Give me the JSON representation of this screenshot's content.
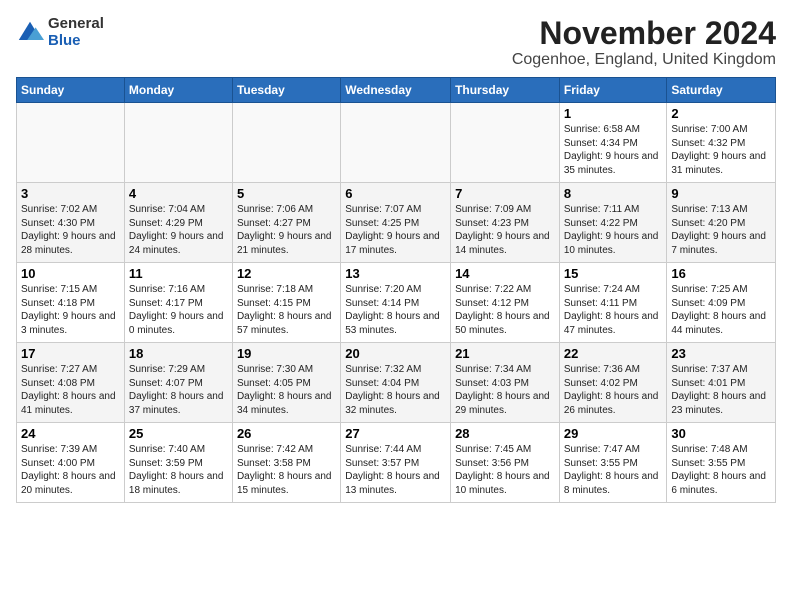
{
  "logo": {
    "general": "General",
    "blue": "Blue"
  },
  "title": "November 2024",
  "location": "Cogenhoe, England, United Kingdom",
  "days_of_week": [
    "Sunday",
    "Monday",
    "Tuesday",
    "Wednesday",
    "Thursday",
    "Friday",
    "Saturday"
  ],
  "weeks": [
    [
      {
        "day": "",
        "info": ""
      },
      {
        "day": "",
        "info": ""
      },
      {
        "day": "",
        "info": ""
      },
      {
        "day": "",
        "info": ""
      },
      {
        "day": "",
        "info": ""
      },
      {
        "day": "1",
        "info": "Sunrise: 6:58 AM\nSunset: 4:34 PM\nDaylight: 9 hours and 35 minutes."
      },
      {
        "day": "2",
        "info": "Sunrise: 7:00 AM\nSunset: 4:32 PM\nDaylight: 9 hours and 31 minutes."
      }
    ],
    [
      {
        "day": "3",
        "info": "Sunrise: 7:02 AM\nSunset: 4:30 PM\nDaylight: 9 hours and 28 minutes."
      },
      {
        "day": "4",
        "info": "Sunrise: 7:04 AM\nSunset: 4:29 PM\nDaylight: 9 hours and 24 minutes."
      },
      {
        "day": "5",
        "info": "Sunrise: 7:06 AM\nSunset: 4:27 PM\nDaylight: 9 hours and 21 minutes."
      },
      {
        "day": "6",
        "info": "Sunrise: 7:07 AM\nSunset: 4:25 PM\nDaylight: 9 hours and 17 minutes."
      },
      {
        "day": "7",
        "info": "Sunrise: 7:09 AM\nSunset: 4:23 PM\nDaylight: 9 hours and 14 minutes."
      },
      {
        "day": "8",
        "info": "Sunrise: 7:11 AM\nSunset: 4:22 PM\nDaylight: 9 hours and 10 minutes."
      },
      {
        "day": "9",
        "info": "Sunrise: 7:13 AM\nSunset: 4:20 PM\nDaylight: 9 hours and 7 minutes."
      }
    ],
    [
      {
        "day": "10",
        "info": "Sunrise: 7:15 AM\nSunset: 4:18 PM\nDaylight: 9 hours and 3 minutes."
      },
      {
        "day": "11",
        "info": "Sunrise: 7:16 AM\nSunset: 4:17 PM\nDaylight: 9 hours and 0 minutes."
      },
      {
        "day": "12",
        "info": "Sunrise: 7:18 AM\nSunset: 4:15 PM\nDaylight: 8 hours and 57 minutes."
      },
      {
        "day": "13",
        "info": "Sunrise: 7:20 AM\nSunset: 4:14 PM\nDaylight: 8 hours and 53 minutes."
      },
      {
        "day": "14",
        "info": "Sunrise: 7:22 AM\nSunset: 4:12 PM\nDaylight: 8 hours and 50 minutes."
      },
      {
        "day": "15",
        "info": "Sunrise: 7:24 AM\nSunset: 4:11 PM\nDaylight: 8 hours and 47 minutes."
      },
      {
        "day": "16",
        "info": "Sunrise: 7:25 AM\nSunset: 4:09 PM\nDaylight: 8 hours and 44 minutes."
      }
    ],
    [
      {
        "day": "17",
        "info": "Sunrise: 7:27 AM\nSunset: 4:08 PM\nDaylight: 8 hours and 41 minutes."
      },
      {
        "day": "18",
        "info": "Sunrise: 7:29 AM\nSunset: 4:07 PM\nDaylight: 8 hours and 37 minutes."
      },
      {
        "day": "19",
        "info": "Sunrise: 7:30 AM\nSunset: 4:05 PM\nDaylight: 8 hours and 34 minutes."
      },
      {
        "day": "20",
        "info": "Sunrise: 7:32 AM\nSunset: 4:04 PM\nDaylight: 8 hours and 32 minutes."
      },
      {
        "day": "21",
        "info": "Sunrise: 7:34 AM\nSunset: 4:03 PM\nDaylight: 8 hours and 29 minutes."
      },
      {
        "day": "22",
        "info": "Sunrise: 7:36 AM\nSunset: 4:02 PM\nDaylight: 8 hours and 26 minutes."
      },
      {
        "day": "23",
        "info": "Sunrise: 7:37 AM\nSunset: 4:01 PM\nDaylight: 8 hours and 23 minutes."
      }
    ],
    [
      {
        "day": "24",
        "info": "Sunrise: 7:39 AM\nSunset: 4:00 PM\nDaylight: 8 hours and 20 minutes."
      },
      {
        "day": "25",
        "info": "Sunrise: 7:40 AM\nSunset: 3:59 PM\nDaylight: 8 hours and 18 minutes."
      },
      {
        "day": "26",
        "info": "Sunrise: 7:42 AM\nSunset: 3:58 PM\nDaylight: 8 hours and 15 minutes."
      },
      {
        "day": "27",
        "info": "Sunrise: 7:44 AM\nSunset: 3:57 PM\nDaylight: 8 hours and 13 minutes."
      },
      {
        "day": "28",
        "info": "Sunrise: 7:45 AM\nSunset: 3:56 PM\nDaylight: 8 hours and 10 minutes."
      },
      {
        "day": "29",
        "info": "Sunrise: 7:47 AM\nSunset: 3:55 PM\nDaylight: 8 hours and 8 minutes."
      },
      {
        "day": "30",
        "info": "Sunrise: 7:48 AM\nSunset: 3:55 PM\nDaylight: 8 hours and 6 minutes."
      }
    ]
  ]
}
